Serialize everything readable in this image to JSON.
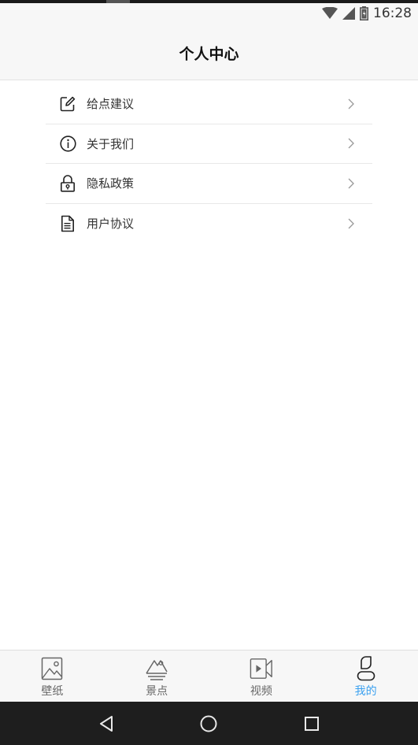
{
  "status_bar": {
    "time": "16:28",
    "icons": [
      "wifi-icon",
      "cellular-signal-icon",
      "battery-icon"
    ]
  },
  "header": {
    "title": "个人中心"
  },
  "menu": {
    "items": [
      {
        "label": "给点建议",
        "icon": "edit-icon"
      },
      {
        "label": "关于我们",
        "icon": "info-icon"
      },
      {
        "label": "隐私政策",
        "icon": "lock-icon"
      },
      {
        "label": "用户协议",
        "icon": "document-icon"
      }
    ]
  },
  "tabs": [
    {
      "label": "壁纸",
      "icon": "image-icon",
      "active": false
    },
    {
      "label": "景点",
      "icon": "mountain-icon",
      "active": false
    },
    {
      "label": "视频",
      "icon": "video-icon",
      "active": false
    },
    {
      "label": "我的",
      "icon": "user-icon",
      "active": true
    }
  ],
  "nav": {
    "buttons": [
      "back-icon",
      "home-icon",
      "recents-icon"
    ]
  },
  "colors": {
    "accent": "#3aa0f0",
    "header_bg": "#f7f7f7",
    "nav_bg": "#1e1e1e"
  }
}
